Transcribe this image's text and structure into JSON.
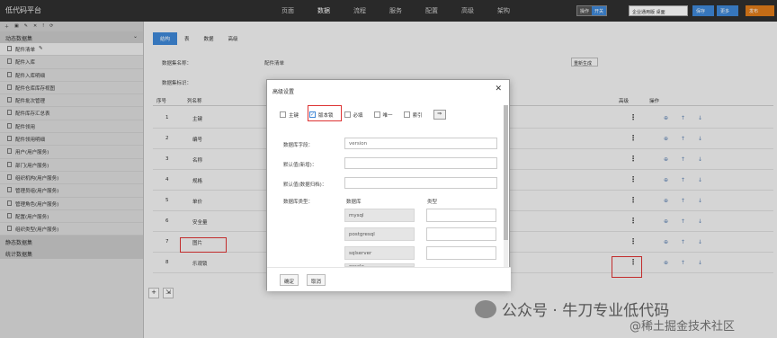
{
  "topbar": {
    "app_title": "低代码平台",
    "nav": [
      "页面",
      "数据",
      "流程",
      "服务",
      "配置",
      "高级",
      "架构"
    ],
    "active_nav": 1,
    "toggle": [
      "操作",
      "开关"
    ],
    "search_value": "企业通用版 桌面",
    "btn_deploy": "保存",
    "btn_more": "更多",
    "btn_publish": "发布"
  },
  "sidebar": {
    "group1": "动态数据集",
    "group2": "静态数据集",
    "group3": "统计数据集",
    "items": [
      "配件清单",
      "配件入库",
      "配件入库明细",
      "配件仓库库存视图",
      "配件批次管理",
      "配件库存汇总表",
      "配件领用",
      "配件领用明细",
      "用户(用户服务)",
      "部门(用户服务)",
      "组织机构(用户服务)",
      "管理员组(用户服务)",
      "管理角色(用户服务)",
      "配置(用户服务)",
      "组织类型(用户服务)"
    ]
  },
  "main": {
    "tabs": [
      "结构",
      "表",
      "数据",
      "高级"
    ],
    "dataset_name_label": "数据集名称：",
    "dataset_name_value": "配件清单",
    "dataset_id_label": "数据集标识：",
    "regen_label": "重新生成",
    "columns": [
      "序号",
      "列名称",
      "高级",
      "操作"
    ],
    "rows": [
      {
        "index": "1",
        "name": "主键"
      },
      {
        "index": "2",
        "name": "编号"
      },
      {
        "index": "3",
        "name": "名称"
      },
      {
        "index": "4",
        "name": "规格"
      },
      {
        "index": "5",
        "name": "单价"
      },
      {
        "index": "6",
        "name": "安全量"
      },
      {
        "index": "7",
        "name": "图片"
      },
      {
        "index": "8",
        "name": "乐观锁"
      }
    ],
    "row_ops": "⊕ ↑ ↓",
    "dots": "⋮"
  },
  "modal": {
    "title": "高级设置",
    "close": "✕",
    "checkboxes": [
      {
        "label": "主键",
        "checked": false
      },
      {
        "label": "版本锁",
        "checked": true
      },
      {
        "label": "必填",
        "checked": false
      },
      {
        "label": "唯一",
        "checked": false
      },
      {
        "label": "索引",
        "checked": false
      }
    ],
    "arrow": "⇒",
    "field_label": "数据库字段：",
    "field_value": "version",
    "default_add_label": "默认值(新增)：",
    "default_edit_label": "默认值(数据归档)：",
    "db_type_label": "数据库类型：",
    "col_db": "数据库",
    "col_type": "类型",
    "databases": [
      "mysql",
      "postgresql",
      "sqlserver",
      "oracle"
    ],
    "ok": "确定",
    "cancel": "取消"
  },
  "watermark": {
    "main": "公众号 · 牛刀专业低代码",
    "sub": "@稀土掘金技术社区"
  }
}
